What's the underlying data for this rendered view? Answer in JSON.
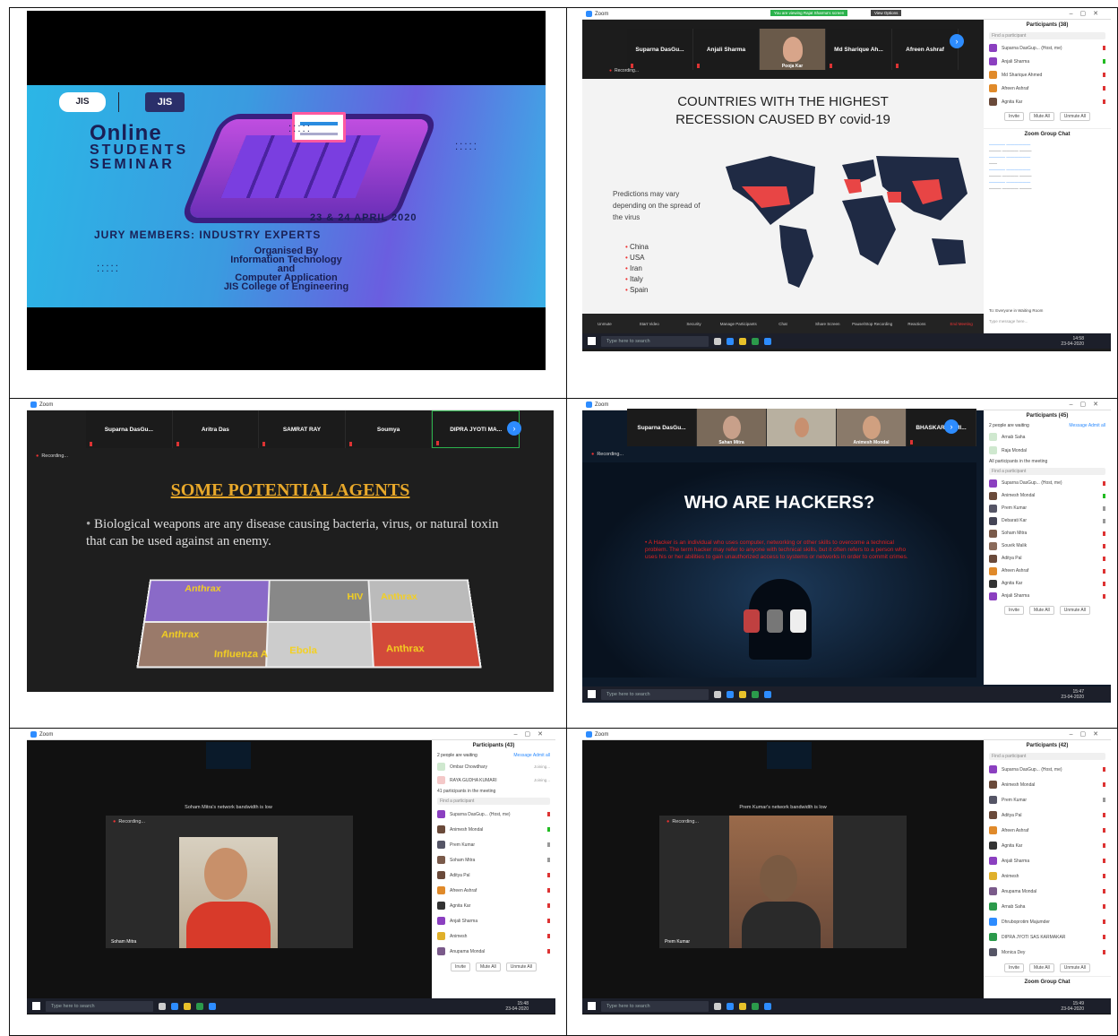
{
  "poster": {
    "logo1": "JIS",
    "logo2": "JIS",
    "title_line1": "Online",
    "title_line2": "STUDENTS",
    "title_line3": "SEMINAR",
    "dates": "23 & 24 APRIL 2020",
    "jury": "JURY MEMBERS: INDUSTRY EXPERTS",
    "organised_by": "Organised By",
    "org_line1": "Information Technology",
    "org_line2": "and",
    "org_line3": "Computer Application",
    "org_line4": "JIS College of Engineering"
  },
  "zoom": {
    "app_name": "Zoom",
    "recording": "Recording...",
    "search_placeholder": "Type here to search",
    "find_participant": "Find a participant",
    "invite": "Invite",
    "mute_all": "Mute All",
    "unmute_all": "Unmute All"
  },
  "shot1": {
    "banner": "You are viewing Rajat Sharma's screen",
    "view_options": "View Options",
    "tiles": [
      "Suparna DasGu...",
      "Anjali Sharma",
      "",
      "Md Sharique Ah...",
      "Afreen Ashraf"
    ],
    "video_name": "Pooja Kar",
    "slide_title_1": "COUNTRIES WITH THE HIGHEST",
    "slide_title_2": "RECESSION CAUSED BY covid-19",
    "predictions": "Predictions may vary depending on the spread of the virus",
    "countries": [
      "China",
      "USA",
      "Iran",
      "Italy",
      "Spain"
    ],
    "participants_title": "Participants (38)",
    "participants": [
      "Suparna DasGup... (Host, me)",
      "Anjali Sharma",
      "Md Sharique Ahmed",
      "Afreen Ashraf",
      "Agnita Kar"
    ],
    "chat_title": "Zoom Group Chat",
    "chat_to": "To: Everyone in Waiting Room",
    "chat_placeholder": "Type message here...",
    "controls": [
      "Unmute",
      "Start Video",
      "Security",
      "Manage Participants",
      "Chat",
      "Share Screen",
      "Pause/Stop Recording",
      "Reactions"
    ],
    "end_meeting": "End Meeting",
    "time": "14:58",
    "date": "23-04-2020"
  },
  "shot2": {
    "tiles": [
      "Suparna DasGu...",
      "Aritra Das",
      "SAMRAT RAY",
      "Soumya",
      "DIPRA JYOTI MA..."
    ],
    "slide_title": "SOME POTENTIAL AGENTS",
    "slide_text": "Biological weapons are any disease causing bacteria, virus, or natural toxin that can be used against an enemy.",
    "labels": [
      "Anthrax",
      "HIV",
      "Anthrax",
      "Anthrax",
      "Influenza A",
      "Ebola",
      "Anthrax"
    ]
  },
  "shot3": {
    "tiles": [
      "Suparna DasGu...",
      "Sahan Mitra",
      "",
      "Animesh Mondal",
      "BHASKAR KAMI..."
    ],
    "slide_title": "WHO ARE HACKERS?",
    "slide_text": "A Hacker is an individual who uses computer, networking or other skills to overcome a technical problem. The term hacker may refer to anyone with technical skills, but it often refers to a person who uses his or her abilities to gain unauthorized access to systems or networks in order to commit crimes.",
    "participants_title": "Participants (45)",
    "waiting": "2 people are waiting",
    "message": "Message",
    "admit_all": "Admit all",
    "waiting_people": [
      "Arnab Saha",
      "Raja Mondal"
    ],
    "in_meeting": "All participants in the meeting",
    "participants": [
      "Suparna DasGup... (Host, me)",
      "Animesh Mondal",
      "Prem Kumar",
      "Debarati Kar",
      "Soham Mitra",
      "Souvik Malik",
      "Aditya Pal",
      "Afreen Ashraf",
      "Agnita Kar",
      "Anjali Sharma"
    ],
    "time": "15:47",
    "date": "23-04-2020"
  },
  "shot4": {
    "bandwidth": "Soham Mitra's network bandwidth is low",
    "video_name": "Soham Mitra",
    "participants_title": "Participants (43)",
    "waiting": "2 people are waiting",
    "message": "Message",
    "admit_all": "Admit all",
    "waiting_people": [
      "Ombar Chowdhary",
      "RAYA GUDHA KUMARI"
    ],
    "waiting_status": "Joining...",
    "in_meeting": "41 participants in the meeting",
    "participants": [
      "Suparna DasGup... (Host, me)",
      "Animesh Mondal",
      "Prem Kumar",
      "Soham Mitra",
      "Aditya Pal",
      "Afreen Ashraf",
      "Agnita Kar",
      "Anjali Sharma",
      "Animesh",
      "Anupama Mondal"
    ],
    "time": "15:48",
    "date": "23-04-2020"
  },
  "shot5": {
    "bandwidth": "Prem Kumar's network bandwidth is low",
    "video_name": "Prem Kumar",
    "participants_title": "Participants (42)",
    "participants": [
      "Suparna DasGup... (Host, me)",
      "Animesh Mondal",
      "Prem Kumar",
      "Aditya Pal",
      "Afreen Ashraf",
      "Agnita Kar",
      "Anjali Sharma",
      "Animesh",
      "Anupama Mondal",
      "Arnab Saha",
      "Dhruboprotim Majumder",
      "DIPRA JYOTI SAS KARMAKAR",
      "Monica Dey"
    ],
    "chat_title": "Zoom Group Chat",
    "time": "15:49",
    "date": "23-04-2020"
  },
  "colors": {
    "zoom_blue": "#2d8cff",
    "map_red": "#e84545",
    "map_navy": "#1f2a44",
    "agents_title": "#e8a82a",
    "hacker_text": "#e02020"
  }
}
